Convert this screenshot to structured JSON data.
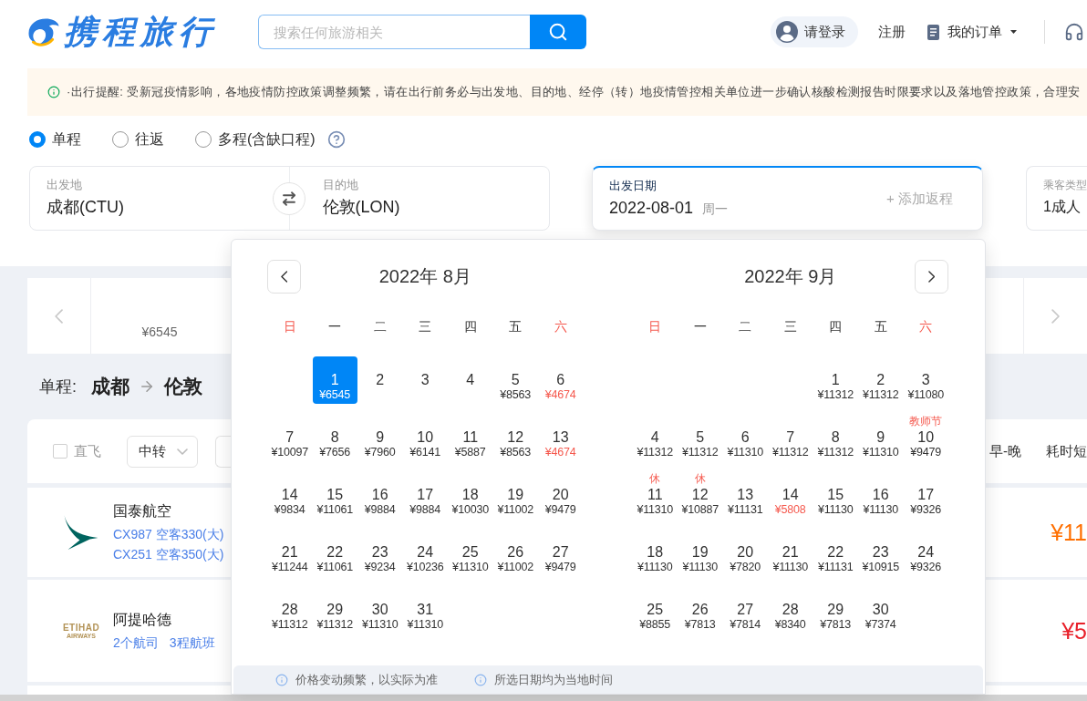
{
  "header": {
    "logo": "携程旅行",
    "search": {
      "placeholder": "搜索任何旅游相关"
    },
    "login": "请登录",
    "register": "注册",
    "orders": "我的订单"
  },
  "notice": "·出行提醒: 受新冠疫情影响，各地疫情防控政策调整频繁，请在出行前务必与出发地、目的地、经停（转）地疫情管控相关单位进一步确认核酸检测报告时限要求以及落地管控政策，合理安",
  "trip_types": [
    {
      "label": "单程",
      "selected": true
    },
    {
      "label": "往返",
      "selected": false
    },
    {
      "label": "多程(含缺口程)",
      "selected": false
    }
  ],
  "search_form": {
    "from": {
      "label": "出发地",
      "value": "成都(CTU)"
    },
    "to": {
      "label": "目的地",
      "value": "伦敦(LON)"
    },
    "date": {
      "label": "出发日期",
      "value": "2022-08-01",
      "weekday": "周一",
      "active": true
    },
    "add_return": "+ 添加返程",
    "passengers": {
      "label": "乘客类型",
      "value": "1成人"
    }
  },
  "date_strip": {
    "items": [
      {
        "price": "¥6545"
      }
    ]
  },
  "route": {
    "label": "单程:",
    "from": "成都",
    "to": "伦敦"
  },
  "filters": {
    "direct": {
      "label": "直飞",
      "checked": false
    },
    "dropdowns": [
      {
        "kind": "labeled",
        "label": "中转"
      },
      {
        "kind": "covered"
      }
    ],
    "sorts": [
      "早-晚",
      "耗时短"
    ]
  },
  "flights": [
    {
      "kind": "wing",
      "airline": "国泰航空",
      "links": [
        "CX987 空客330(大)",
        "CX251 空客350(大)"
      ],
      "price": {
        "text": "¥11",
        "color": "#ff6f00"
      }
    },
    {
      "kind": "wordmark",
      "logo_text": [
        "ETIHAD",
        "AIRWAYS"
      ],
      "airline": "阿提哈德",
      "links": [
        "2个航司",
        "3程航班"
      ],
      "price": {
        "text": "¥5",
        "color": "#e8202a"
      }
    }
  ],
  "calendar": {
    "months": [
      {
        "title": "2022年 8月",
        "weekdays": [
          {
            "label": "日",
            "weekend": true
          },
          {
            "label": "一",
            "weekend": false
          },
          {
            "label": "二",
            "weekend": false
          },
          {
            "label": "三",
            "weekend": false
          },
          {
            "label": "四",
            "weekend": false
          },
          {
            "label": "五",
            "weekend": false
          },
          {
            "label": "六",
            "weekend": true
          }
        ],
        "weeks": [
          [
            {
              "kind": "blank"
            },
            {
              "kind": "day",
              "day": "1",
              "price": "¥6545",
              "selected": true,
              "low_price": false
            },
            {
              "kind": "day",
              "day": "2",
              "selected": false
            },
            {
              "kind": "day",
              "day": "3",
              "selected": false
            },
            {
              "kind": "day",
              "day": "4",
              "selected": false
            },
            {
              "kind": "day",
              "day": "5",
              "price": "¥8563",
              "selected": false,
              "low_price": false
            },
            {
              "kind": "day",
              "day": "6",
              "price": "¥4674",
              "selected": false,
              "low_price": true
            }
          ],
          [
            {
              "kind": "day",
              "day": "7",
              "price": "¥10097",
              "selected": false,
              "low_price": false
            },
            {
              "kind": "day",
              "day": "8",
              "price": "¥7656",
              "selected": false,
              "low_price": false
            },
            {
              "kind": "day",
              "day": "9",
              "price": "¥7960",
              "selected": false,
              "low_price": false
            },
            {
              "kind": "day",
              "day": "10",
              "price": "¥6141",
              "selected": false,
              "low_price": false
            },
            {
              "kind": "day",
              "day": "11",
              "price": "¥5887",
              "selected": false,
              "low_price": false
            },
            {
              "kind": "day",
              "day": "12",
              "price": "¥8563",
              "selected": false,
              "low_price": false
            },
            {
              "kind": "day",
              "day": "13",
              "price": "¥4674",
              "selected": false,
              "low_price": true
            }
          ],
          [
            {
              "kind": "day",
              "day": "14",
              "price": "¥9834",
              "selected": false,
              "low_price": false
            },
            {
              "kind": "day",
              "day": "15",
              "price": "¥11061",
              "selected": false,
              "low_price": false
            },
            {
              "kind": "day",
              "day": "16",
              "price": "¥9884",
              "selected": false,
              "low_price": false
            },
            {
              "kind": "day",
              "day": "17",
              "price": "¥9884",
              "selected": false,
              "low_price": false
            },
            {
              "kind": "day",
              "day": "18",
              "price": "¥10030",
              "selected": false,
              "low_price": false
            },
            {
              "kind": "day",
              "day": "19",
              "price": "¥11002",
              "selected": false,
              "low_price": false
            },
            {
              "kind": "day",
              "day": "20",
              "price": "¥9479",
              "selected": false,
              "low_price": false
            }
          ],
          [
            {
              "kind": "day",
              "day": "21",
              "price": "¥11244",
              "selected": false,
              "low_price": false
            },
            {
              "kind": "day",
              "day": "22",
              "price": "¥11061",
              "selected": false,
              "low_price": false
            },
            {
              "kind": "day",
              "day": "23",
              "price": "¥9234",
              "selected": false,
              "low_price": false
            },
            {
              "kind": "day",
              "day": "24",
              "price": "¥10236",
              "selected": false,
              "low_price": false
            },
            {
              "kind": "day",
              "day": "25",
              "price": "¥11310",
              "selected": false,
              "low_price": false
            },
            {
              "kind": "day",
              "day": "26",
              "price": "¥11002",
              "selected": false,
              "low_price": false
            },
            {
              "kind": "day",
              "day": "27",
              "price": "¥9479",
              "selected": false,
              "low_price": false
            }
          ],
          [
            {
              "kind": "day",
              "day": "28",
              "price": "¥11312",
              "selected": false,
              "low_price": false
            },
            {
              "kind": "day",
              "day": "29",
              "price": "¥11312",
              "selected": false,
              "low_price": false
            },
            {
              "kind": "day",
              "day": "30",
              "price": "¥11310",
              "selected": false,
              "low_price": false
            },
            {
              "kind": "day",
              "day": "31",
              "price": "¥11310",
              "selected": false,
              "low_price": false
            }
          ]
        ]
      },
      {
        "title": "2022年 9月",
        "weekdays": [
          {
            "label": "日",
            "weekend": true
          },
          {
            "label": "一",
            "weekend": false
          },
          {
            "label": "二",
            "weekend": false
          },
          {
            "label": "三",
            "weekend": false
          },
          {
            "label": "四",
            "weekend": false
          },
          {
            "label": "五",
            "weekend": false
          },
          {
            "label": "六",
            "weekend": true
          }
        ],
        "weeks": [
          [
            {
              "kind": "blank"
            },
            {
              "kind": "blank"
            },
            {
              "kind": "blank"
            },
            {
              "kind": "blank"
            },
            {
              "kind": "day",
              "day": "1",
              "price": "¥11312",
              "selected": false,
              "low_price": false
            },
            {
              "kind": "day",
              "day": "2",
              "price": "¥11312",
              "selected": false,
              "low_price": false
            },
            {
              "kind": "day",
              "day": "3",
              "price": "¥11080",
              "selected": false,
              "low_price": false
            }
          ],
          [
            {
              "kind": "day",
              "day": "4",
              "price": "¥11312",
              "selected": false,
              "low_price": false
            },
            {
              "kind": "day",
              "day": "5",
              "price": "¥11312",
              "selected": false,
              "low_price": false
            },
            {
              "kind": "day",
              "day": "6",
              "price": "¥11310",
              "selected": false,
              "low_price": false
            },
            {
              "kind": "day",
              "day": "7",
              "price": "¥11312",
              "selected": false,
              "low_price": false
            },
            {
              "kind": "day",
              "day": "8",
              "price": "¥11312",
              "selected": false,
              "low_price": false
            },
            {
              "kind": "day",
              "day": "9",
              "price": "¥11310",
              "selected": false,
              "low_price": false
            },
            {
              "kind": "day",
              "day": "10",
              "holiday": "教师节",
              "price": "¥9479",
              "selected": false,
              "low_price": false
            }
          ],
          [
            {
              "kind": "day",
              "day": "11",
              "holiday": "休",
              "price": "¥11310",
              "selected": false,
              "low_price": false
            },
            {
              "kind": "day",
              "day": "12",
              "holiday": "休",
              "price": "¥10887",
              "selected": false,
              "low_price": false
            },
            {
              "kind": "day",
              "day": "13",
              "price": "¥11131",
              "selected": false,
              "low_price": false
            },
            {
              "kind": "day",
              "day": "14",
              "price": "¥5808",
              "selected": false,
              "low_price": true
            },
            {
              "kind": "day",
              "day": "15",
              "price": "¥11130",
              "selected": false,
              "low_price": false
            },
            {
              "kind": "day",
              "day": "16",
              "price": "¥11130",
              "selected": false,
              "low_price": false
            },
            {
              "kind": "day",
              "day": "17",
              "price": "¥9326",
              "selected": false,
              "low_price": false
            }
          ],
          [
            {
              "kind": "day",
              "day": "18",
              "price": "¥11130",
              "selected": false,
              "low_price": false
            },
            {
              "kind": "day",
              "day": "19",
              "price": "¥11130",
              "selected": false,
              "low_price": false
            },
            {
              "kind": "day",
              "day": "20",
              "price": "¥7820",
              "selected": false,
              "low_price": false
            },
            {
              "kind": "day",
              "day": "21",
              "price": "¥11130",
              "selected": false,
              "low_price": false
            },
            {
              "kind": "day",
              "day": "22",
              "price": "¥11131",
              "selected": false,
              "low_price": false
            },
            {
              "kind": "day",
              "day": "23",
              "price": "¥10915",
              "selected": false,
              "low_price": false
            },
            {
              "kind": "day",
              "day": "24",
              "price": "¥9326",
              "selected": false,
              "low_price": false
            }
          ],
          [
            {
              "kind": "day",
              "day": "25",
              "price": "¥8855",
              "selected": false,
              "low_price": false
            },
            {
              "kind": "day",
              "day": "26",
              "price": "¥7813",
              "selected": false,
              "low_price": false
            },
            {
              "kind": "day",
              "day": "27",
              "price": "¥7814",
              "selected": false,
              "low_price": false
            },
            {
              "kind": "day",
              "day": "28",
              "price": "¥8340",
              "selected": false,
              "low_price": false
            },
            {
              "kind": "day",
              "day": "29",
              "price": "¥7813",
              "selected": false,
              "low_price": false
            },
            {
              "kind": "day",
              "day": "30",
              "price": "¥7374",
              "selected": false,
              "low_price": false
            }
          ]
        ]
      }
    ],
    "notes": [
      "价格变动频繁，以实际为准",
      "所选日期均为当地时间"
    ]
  }
}
